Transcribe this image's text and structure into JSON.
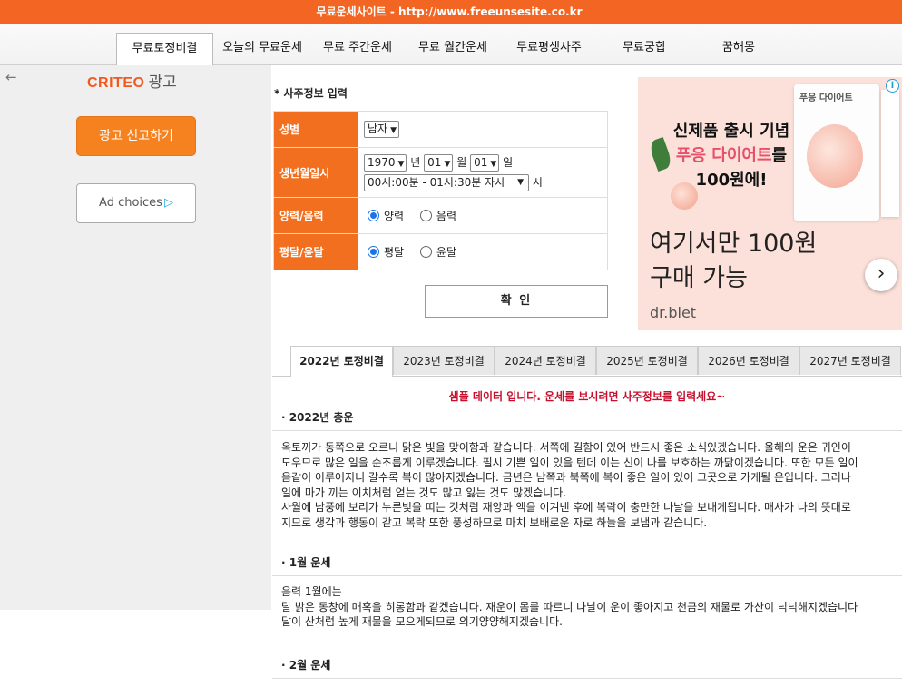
{
  "top_banner": {
    "text": "무료운세사이트 - http://www.freeunsesite.co.kr"
  },
  "nav": {
    "tabs": [
      "무료토정비결",
      "오늘의 무료운세",
      "무료 주간운세",
      "무료 월간운세",
      "무료평생사주",
      "무료궁합",
      "꿈해몽"
    ],
    "active": "무료토정비결"
  },
  "side_ad": {
    "back_icon": "back-arrow-icon",
    "brand": "CRITEO",
    "brand_suffix": "광고",
    "report_button": "광고 신고하기",
    "adchoices_button": "Ad choices",
    "adchoices_icon": "adchoices-triangle-icon",
    "brand_color": "#f05a22",
    "button_color": "#f6821f"
  },
  "form": {
    "title": "* 사주정보 입력",
    "labels": {
      "gender": "성별",
      "birth": "생년월일시",
      "calendar": "양력/음력",
      "leap": "평달/윤달"
    },
    "gender_value": "남자",
    "year_value": "1970",
    "year_unit": "년",
    "month_value": "01",
    "month_unit": "월",
    "day_value": "01",
    "day_unit": "일",
    "time_value": "00시:00분 - 01시:30분 자시",
    "time_unit": "시",
    "calendar_options": [
      "양력",
      "음력"
    ],
    "calendar_selected": "양력",
    "leap_options": [
      "평달",
      "윤달"
    ],
    "leap_selected": "평달",
    "confirm_button": "확 인",
    "label_color": "#f26f1f"
  },
  "big_ad": {
    "product_label": "푸응 다이어트",
    "headline_line1": "신제품 출시 기념",
    "headline_line2_pink": "푸응 다이어트",
    "headline_line2_rest": "를",
    "headline_line3": "100원에!",
    "main_line1": "여기서만 100원",
    "main_line2": "구매 가능",
    "domain": "dr.blet",
    "next_icon": "chevron-right-icon",
    "info_icon": "info-icon",
    "info_text": "i",
    "next_glyph": "›",
    "accent_color": "#e84f6b"
  },
  "year_tabs": {
    "tabs": [
      "2022년 토정비결",
      "2023년 토정비결",
      "2024년 토정비결",
      "2025년 토정비결",
      "2026년 토정비결",
      "2027년 토정비결"
    ],
    "active": "2022년 토정비결"
  },
  "content": {
    "notice": "샘플 데이터 입니다. 운세를 보시려면 사주정보를 입력세요~",
    "notice_color": "#c8102e",
    "sections": [
      {
        "heading": "· 2022년 총운",
        "lines": [
          "옥토끼가 동쪽으로 오르니 맑은 빛을 맞이함과 같습니다. 서쪽에 길함이 있어 반드시 좋은 소식있겠습니다. 올해의 운은 귀인이",
          "도우므로 많은 일을 순조롭게 이루겠습니다. 필시 기쁜 일이 있을 텐데 이는 신이 나를 보호하는 까닭이겠습니다. 또한 모든 일이",
          "음같이 이루어지니 갈수록 복이 많아지겠습니다. 금년은 남쪽과 북쪽에 복이 좋은 일이 있어 그곳으로 가게될 운입니다. 그러나",
          "일에 마가 끼는 이치처럼 얻는 것도 많고 잃는 것도 많겠습니다.",
          "사월에 남풍에 보리가 누른빛을 띠는 것처럼 재앙과 액을 이겨낸 후에 복락이 충만한 나날을 보내게됩니다. 매사가 나의 뜻대로",
          "지므로 생각과 행동이 같고 복락 또한 풍성하므로 마치 보배로운 자로 하늘을 보냄과 같습니다."
        ]
      },
      {
        "heading": "· 1월 운세",
        "lines": [
          "음력 1월에는",
          "달 밝은 동창에 매혹을 히롱함과 같겠습니다. 재운이 몸를 따르니 나날이 운이 좋아지고 천금의 재물로 가산이 넉넉해지겠습니다",
          "달이 산처럼 높게 재물을 모으게되므로 의기양양해지겠습니다."
        ]
      },
      {
        "heading": "· 2월 운세",
        "lines": []
      }
    ]
  }
}
